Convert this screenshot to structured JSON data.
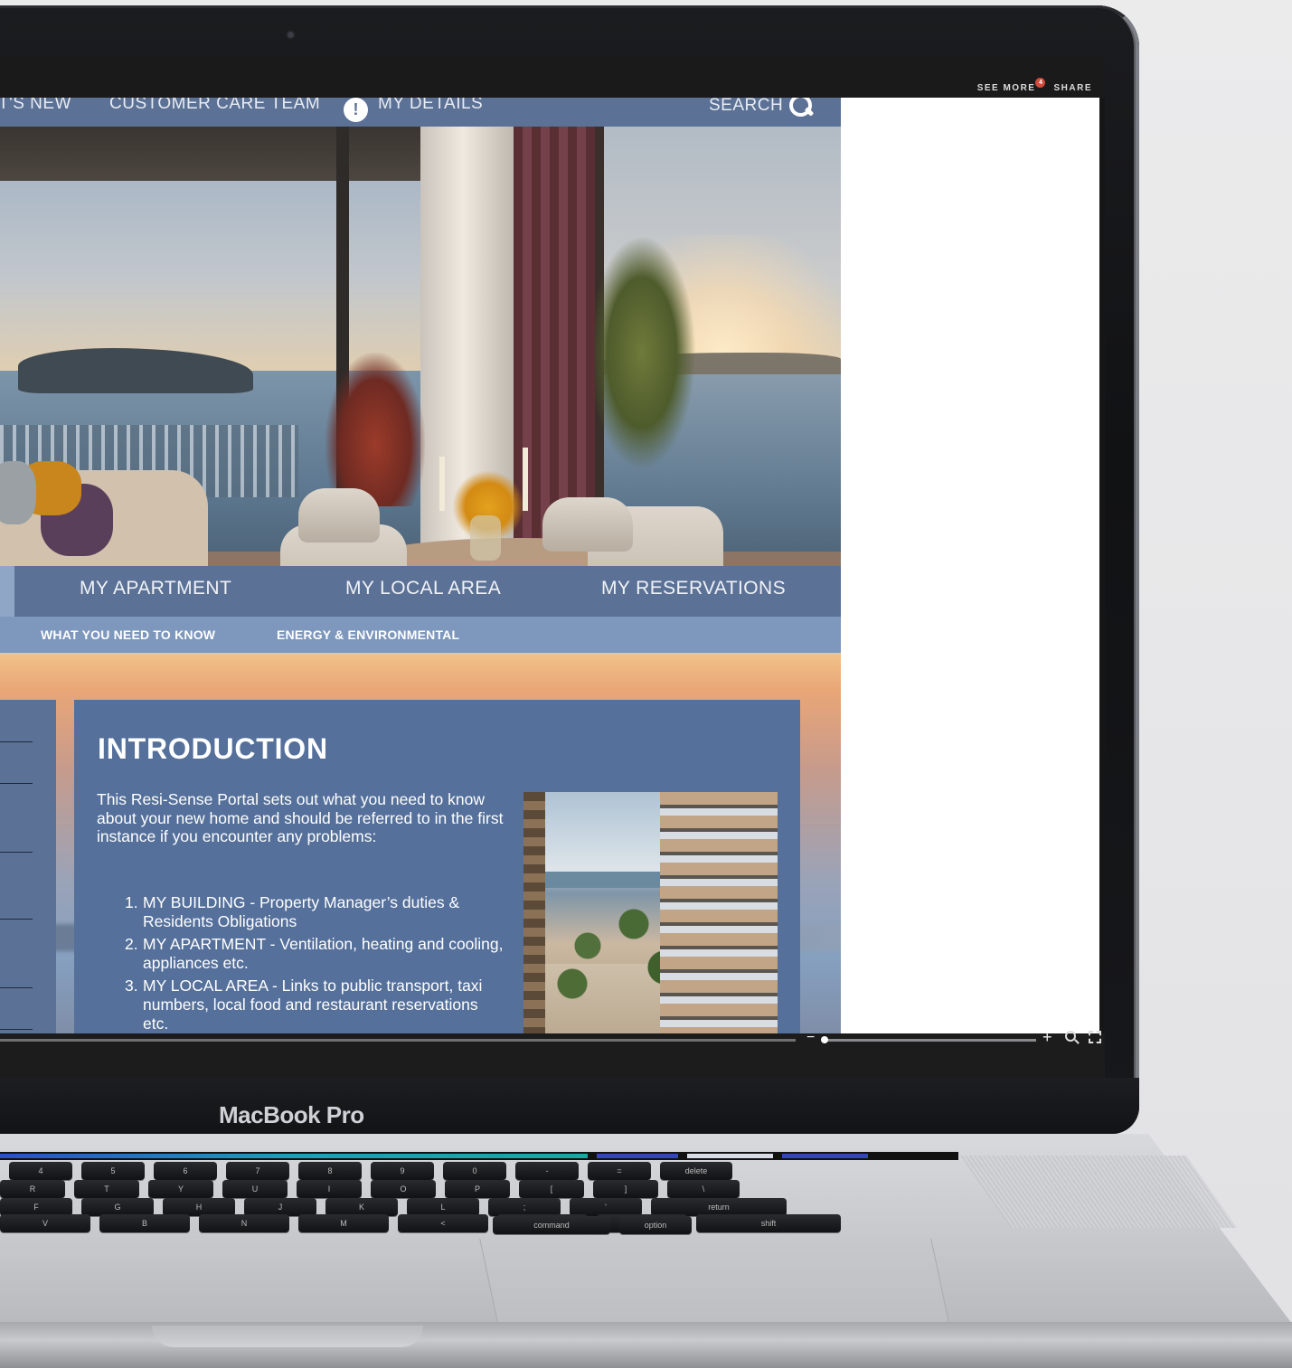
{
  "viewer": {
    "see_more_label": "SEE MORE",
    "see_more_badge": "4",
    "share_label": "SHARE",
    "zoom_minus": "−",
    "zoom_plus": "+"
  },
  "topnav": {
    "items": [
      "T'S NEW",
      "CUSTOMER CARE TEAM",
      "MY DETAILS"
    ],
    "info_glyph": "!",
    "search_label": "SEARCH"
  },
  "mainnav": {
    "items": [
      "MY APARTMENT",
      "MY LOCAL AREA",
      "MY RESERVATIONS"
    ]
  },
  "subnav": {
    "items": [
      "WHAT YOU NEED TO KNOW",
      "ENERGY & ENVIRONMENTAL"
    ]
  },
  "intro": {
    "title": "INTRODUCTION",
    "paragraph": "This Resi-Sense Portal sets out what you need to know about your new home and should be referred to in the first instance if you encounter any problems:",
    "list": [
      {
        "num": "1.",
        "text": "MY BUILDING - Property Manager’s duties & Residents Obligations"
      },
      {
        "num": "2.",
        "text": "MY APARTMENT - Ventilation, heating and cooling, appliances etc."
      },
      {
        "num": "3.",
        "text": "MY LOCAL AREA - Links to public transport, taxi numbers, local food and  restaurant reservations etc."
      }
    ]
  },
  "device": {
    "brand": "MacBook Pro"
  },
  "keyboard": {
    "row1": [
      "4",
      "5",
      "6",
      "7",
      "8",
      "9",
      "0",
      "-",
      "=",
      "delete"
    ],
    "row2": [
      "R",
      "T",
      "Y",
      "U",
      "I",
      "O",
      "P",
      "[",
      "]",
      "\\"
    ],
    "row3": [
      "F",
      "G",
      "H",
      "J",
      "K",
      "L",
      ";",
      "'",
      "return"
    ],
    "row4": [
      "V",
      "B",
      "N",
      "M",
      "<",
      ">",
      "?",
      "shift"
    ],
    "row5": [
      "command",
      "option"
    ]
  },
  "colors": {
    "nav_blue": "#5b7195",
    "subnav_blue": "#7d97bd",
    "intro_panel": "#55709a",
    "badge_red": "#d14a3b"
  }
}
